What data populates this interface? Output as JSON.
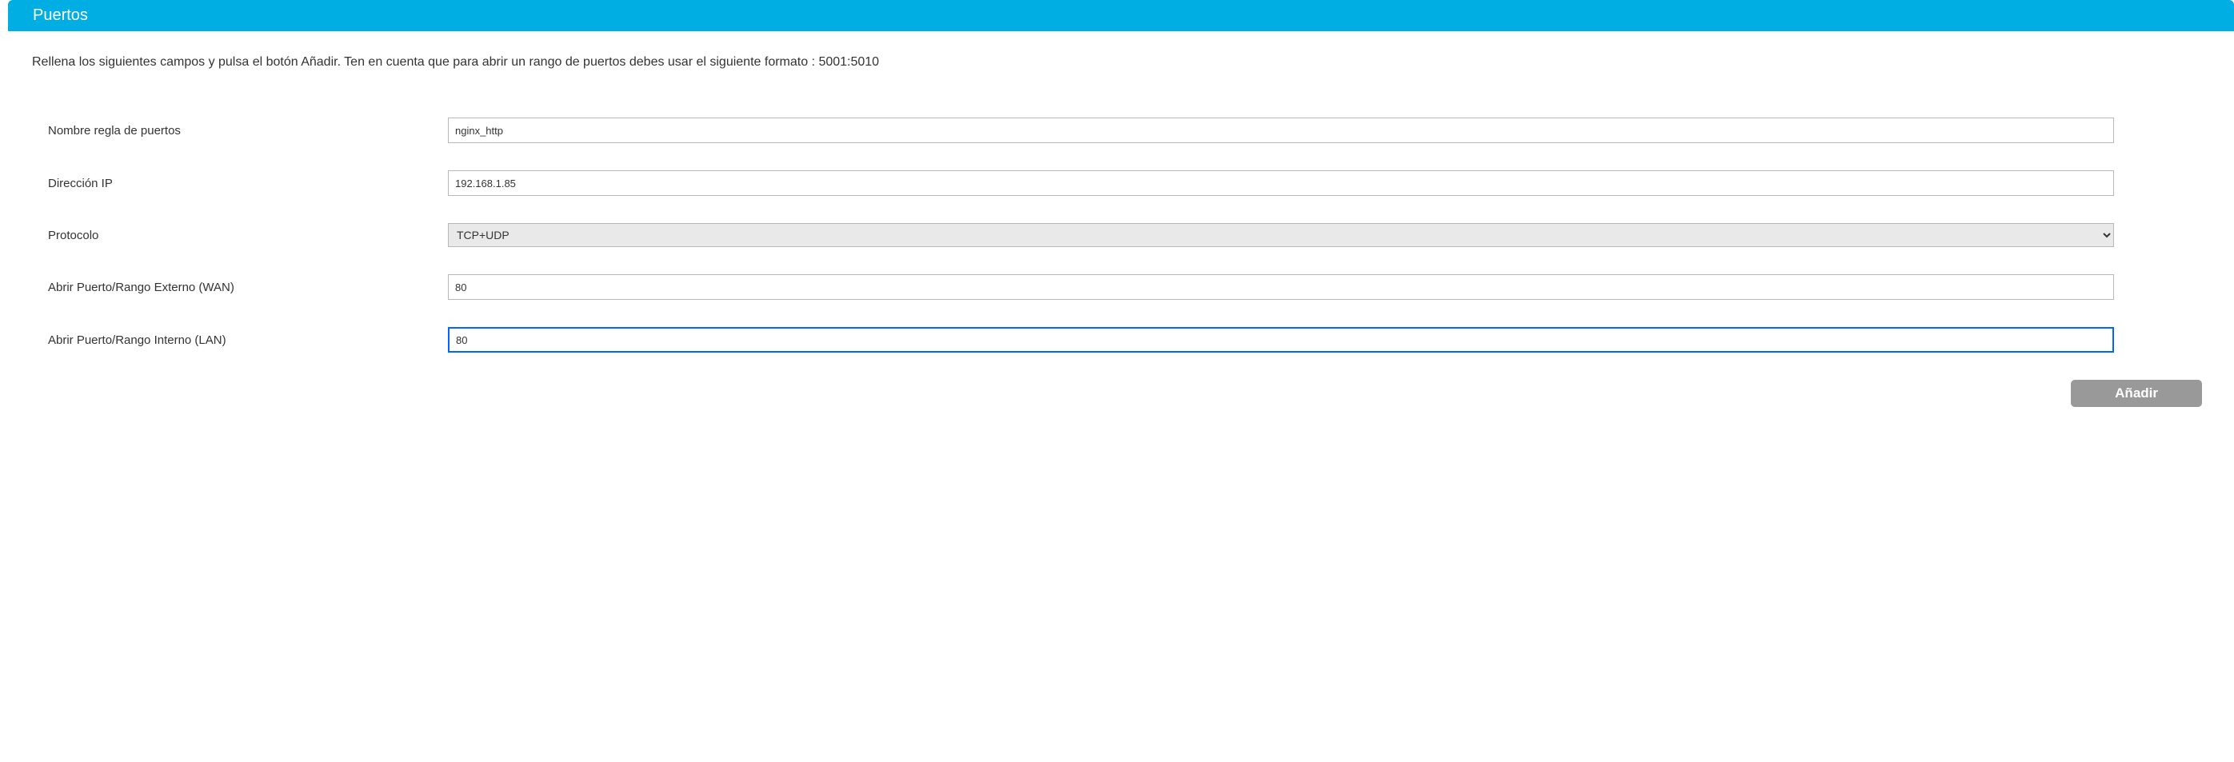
{
  "header": {
    "title": "Puertos"
  },
  "description": "Rellena los siguientes campos y pulsa el botón Añadir. Ten en cuenta que para abrir un rango de puertos debes usar el siguiente formato : 5001:5010",
  "form": {
    "rule_name": {
      "label": "Nombre regla de puertos",
      "value": "nginx_http"
    },
    "ip_address": {
      "label": "Dirección IP",
      "value": "192.168.1.85"
    },
    "protocol": {
      "label": "Protocolo",
      "selected": "TCP+UDP"
    },
    "external_port": {
      "label": "Abrir Puerto/Rango Externo (WAN)",
      "value": "80"
    },
    "internal_port": {
      "label": "Abrir Puerto/Rango Interno (LAN)",
      "value": "80"
    }
  },
  "buttons": {
    "add": "Añadir"
  }
}
